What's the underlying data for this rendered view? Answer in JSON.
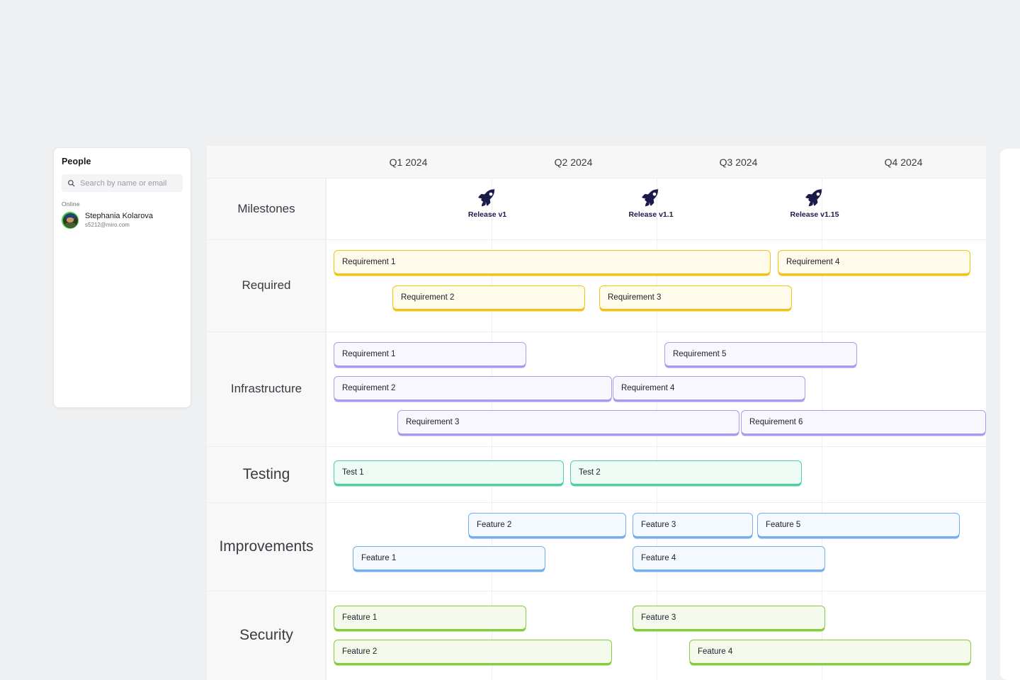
{
  "people_panel": {
    "title": "People",
    "search": {
      "placeholder": "Search by name or email",
      "icon": "search-icon"
    },
    "online_label": "Online",
    "members": [
      {
        "name": "Stephania Kolarova",
        "email": "s5212@miro.com",
        "status": "online"
      }
    ]
  },
  "timeline": {
    "columns": [
      "Q1 2024",
      "Q2 2024",
      "Q3 2024",
      "Q4 2024"
    ],
    "rows": [
      {
        "label": "Milestones",
        "label_size": "small"
      },
      {
        "label": "Required",
        "label_size": "small"
      },
      {
        "label": "Infrastructure",
        "label_size": "small"
      },
      {
        "label": "Testing",
        "label_size": "large"
      },
      {
        "label": "Improvements",
        "label_size": "large"
      },
      {
        "label": "Security",
        "label_size": "large"
      }
    ],
    "milestones": [
      {
        "label": "Release v1",
        "icon": "rocket-icon"
      },
      {
        "label": "Release v1.1",
        "icon": "rocket-icon"
      },
      {
        "label": "Release v1.15",
        "icon": "rocket-icon"
      }
    ],
    "bars": {
      "required": [
        {
          "label": "Requirement 1"
        },
        {
          "label": "Requirement 4"
        },
        {
          "label": "Requirement 2"
        },
        {
          "label": "Requirement 3"
        }
      ],
      "infrastructure": [
        {
          "label": "Requirement 1"
        },
        {
          "label": "Requirement 5"
        },
        {
          "label": "Requirement 2"
        },
        {
          "label": "Requirement 4"
        },
        {
          "label": "Requirement 3"
        },
        {
          "label": "Requirement 6"
        }
      ],
      "testing": [
        {
          "label": "Test 1"
        },
        {
          "label": "Test 2"
        }
      ],
      "improvements": [
        {
          "label": "Feature 2"
        },
        {
          "label": "Feature 3"
        },
        {
          "label": "Feature 5"
        },
        {
          "label": "Feature 1"
        },
        {
          "label": "Feature 4"
        }
      ],
      "security": [
        {
          "label": "Feature 1"
        },
        {
          "label": "Feature 3"
        },
        {
          "label": "Feature 2"
        },
        {
          "label": "Feature 4"
        }
      ]
    },
    "colors": {
      "required": "#f2c218",
      "infrastructure": "#a89bf0",
      "testing": "#4ecfa0",
      "improvements": "#74aeee",
      "security": "#86cc3e",
      "milestone": "#1b1b4b"
    }
  }
}
